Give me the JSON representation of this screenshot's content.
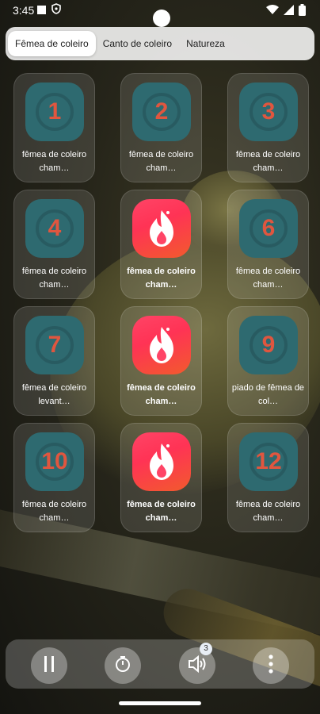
{
  "status_bar": {
    "time": "3:45"
  },
  "tabs": [
    {
      "label": "Fêmea de coleiro",
      "active": true
    },
    {
      "label": "Canto de coleiro",
      "active": false
    },
    {
      "label": "Natureza",
      "active": false
    }
  ],
  "sounds": [
    {
      "icon": "number",
      "number": "1",
      "label": "fêmea de coleiro cham…",
      "playing": false
    },
    {
      "icon": "number",
      "number": "2",
      "label": "fêmea de coleiro cham…",
      "playing": false
    },
    {
      "icon": "number",
      "number": "3",
      "label": "fêmea de coleiro cham…",
      "playing": false
    },
    {
      "icon": "number",
      "number": "4",
      "label": "fêmea de coleiro cham…",
      "playing": false
    },
    {
      "icon": "fire-icon",
      "number": "",
      "label": "fêmea de coleiro cham…",
      "playing": true
    },
    {
      "icon": "number",
      "number": "6",
      "label": "fêmea de coleiro cham…",
      "playing": false
    },
    {
      "icon": "number",
      "number": "7",
      "label": "fêmea de coleiro levant…",
      "playing": false
    },
    {
      "icon": "fire-icon",
      "number": "",
      "label": "fêmea de coleiro cham…",
      "playing": true
    },
    {
      "icon": "number",
      "number": "9",
      "label": "piado de fêmea de col…",
      "playing": false
    },
    {
      "icon": "number",
      "number": "10",
      "label": "fêmea de coleiro cham…",
      "playing": false
    },
    {
      "icon": "fire-icon",
      "number": "",
      "label": "fêmea de coleiro cham…",
      "playing": true
    },
    {
      "icon": "number",
      "number": "12",
      "label": "fêmea de coleiro cham…",
      "playing": false
    }
  ],
  "player": {
    "buttons": [
      "pause-icon",
      "timer-icon",
      "volume-icon",
      "more-vertical-icon"
    ],
    "volume_badge": "3"
  },
  "colors": {
    "number_icon_bg": "#2e6a70",
    "number_color": "#e0563f",
    "fire_gradient_start": "#ff4466",
    "fire_gradient_end": "#f25a2d"
  }
}
